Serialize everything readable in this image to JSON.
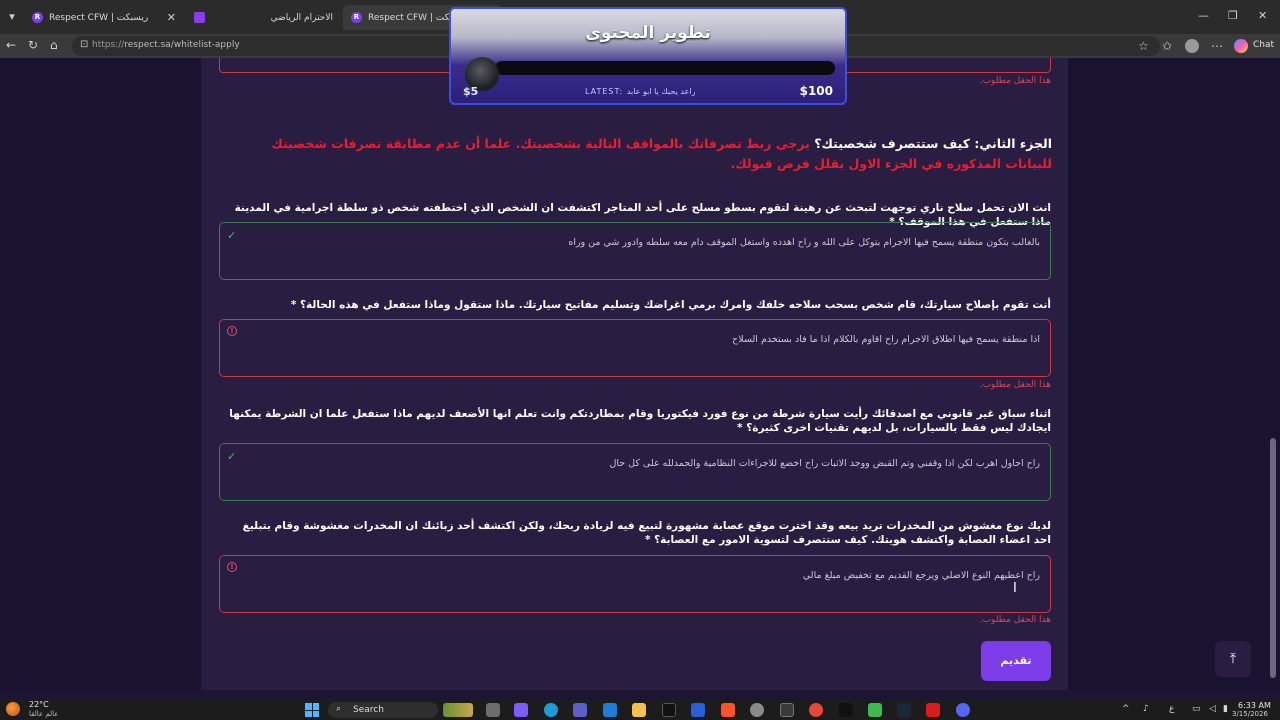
{
  "browser": {
    "tabs": [
      {
        "title": "Respect CFW | ريسبكت",
        "icon": "respect-logo-icon",
        "close": "✕"
      },
      {
        "title": "الاحترام الرياضي",
        "icon": "purple-square-icon",
        "close": ""
      },
      {
        "title": "Respect CFW | ريسبكت",
        "icon": "respect-logo-icon",
        "close": "✕"
      }
    ],
    "url_prefix": "https://",
    "url_main": "respect.sa/whitelist-apply",
    "chat_label": "Chat"
  },
  "overlay": {
    "title": "تطوير المحتوى",
    "min_amount": "$5",
    "latest": "LATEST: راعد يحبك يا ابو عابد",
    "max_amount": "$100"
  },
  "form": {
    "required_msg": "هذا الحقل مطلوب.",
    "section_title_white": "الجزء الثاني: كيف ستتصرف شخصيتك؟",
    "section_title_red": "يرجى ربط تصرفاتك بالمواقف التالية بشخصيتك. علما أن عدم مطابقة تصرفات شخصيتك للبيانات المذكوره في الجزء الاول يقلل فرص قبولك.",
    "questions": [
      {
        "label": "انت الان تحمل سلاح ناري توجهت لتبحث عن رهينة لتقوم بسطو مسلح على أحد المتاجر اكتشفت ان الشخص الذي اختطفته شخص ذو سلطة اجرامية في المدينة ماذا ستفعل في هذا الموقف؟ *",
        "answer": "بالغالب بتكون منطقة يسمح فيها الاجرام بتوكل على الله  و راح اهدده واستغل الموقف دام معه سلطه وادور شي من وراه",
        "state": "valid"
      },
      {
        "label": "أنت تقوم بإصلاح سيارتك، قام شخص بسحب سلاحه خلفك وامرك برمي اغراضك وتسليم مفاتيح سيارتك. ماذا ستقول وماذا ستفعل في هذه الحالة؟ *",
        "answer": "اذا منطقة يسمح فيها اطلاق الاجرام راح اقاوم بالكلام اذا ما فاد بستخدم السلاح",
        "state": "invalid"
      },
      {
        "label": "اثناء سباق غير قانوني مع اصدقائك رأيت سيارة شرطة من نوع فورد فيكتوريا وقام بمطاردتكم وانت تعلم انها الأضعف لديهم ماذا ستفعل علما ان الشرطة يمكنها ايجادك ليس فقط بالسيارات، بل لديهم تقنيات اخرى كثيرة؟ *",
        "answer": "راح احاول اهرب لكن اذا وقفني وتم القبض ووجد الاثبات راح اخضع للاجراءات النظامية والحمدلله على كل حال",
        "state": "valid"
      },
      {
        "label": "لديك نوع مغشوش من المخدرات تريد بيعه وقد اخترت موقع عصابة مشهورة لتبيع فيه لزيادة ربحك، ولكن اكتشف أحد زبائنك ان المخدرات مغشوشة وقام بتبليغ احد اعضاء العصابة واكتشف هويتك. كيف ستتصرف لتسوية الامور مع العصابة؟ *",
        "answer": "راح اعطيهم النوع الاصلي ويرجع القديم مع تخفيض مبلغ مالي",
        "state": "invalid"
      }
    ],
    "submit_label": "تقديم",
    "scroll_top_icon": "arrow-up-icon"
  },
  "taskbar": {
    "temp": "22°C",
    "weather": "عالم عالقا",
    "search_label": "Search",
    "time": "6:33 AM",
    "date": "3/15/2026",
    "lang": "ع"
  },
  "colors": {
    "accent": "#7c3ce8",
    "error": "#d9455c",
    "valid": "#3fbf6b",
    "title_red": "#ee1c2e",
    "page_bg": "#1a1330",
    "card_bg": "#2a1d42"
  }
}
